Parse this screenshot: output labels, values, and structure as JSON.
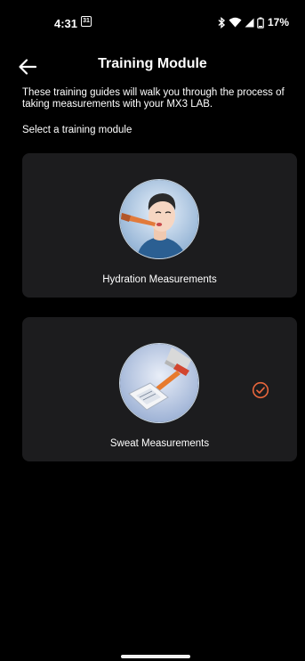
{
  "status_bar": {
    "time": "4:31",
    "calendar_day": "31",
    "battery_percent": "17%"
  },
  "header": {
    "title": "Training Module"
  },
  "intro_text": "These training guides will walk you through the process of taking measurements with your MX3 LAB.",
  "select_label": "Select a training module",
  "modules": [
    {
      "label": "Hydration Measurements",
      "completed": false,
      "image_icon": "person-saliva-test-illustration"
    },
    {
      "label": "Sweat Measurements",
      "completed": true,
      "image_icon": "sweat-patch-test-strip-illustration"
    }
  ],
  "colors": {
    "background": "#000000",
    "card": "#1c1c1e",
    "accent_check": "#e8663c"
  }
}
